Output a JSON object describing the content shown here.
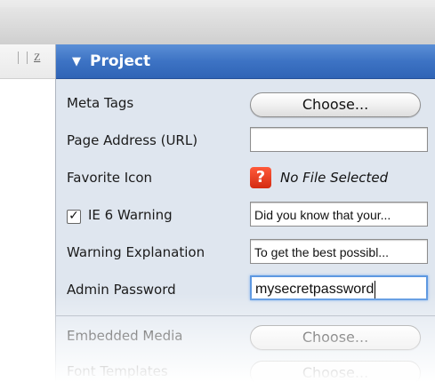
{
  "ruler": {
    "label": "Z"
  },
  "panel": {
    "title": "Project",
    "rows": {
      "meta_tags": {
        "label": "Meta Tags",
        "button": "Choose..."
      },
      "page_address": {
        "label": "Page Address (URL)",
        "value": ""
      },
      "favorite_icon": {
        "label": "Favorite Icon",
        "icon_symbol": "?",
        "status": "No File Selected"
      },
      "ie6_warning": {
        "label": "IE 6 Warning",
        "checked": true,
        "check_symbol": "✓",
        "value": "Did you know that your..."
      },
      "warning_explanation": {
        "label": "Warning Explanation",
        "value": "To get the best possibl..."
      },
      "admin_password": {
        "label": "Admin Password",
        "value": "mysecretpassword"
      },
      "embedded_media": {
        "label": "Embedded Media",
        "button": "Choose..."
      },
      "font_templates": {
        "label": "Font Templates",
        "button": "Choose..."
      }
    }
  },
  "colors": {
    "header_blue": "#3d73c4",
    "panel_bg": "#dfe6ef",
    "warning_red": "#d42b12",
    "focus_blue": "#5d98e1"
  },
  "icons": {
    "collapse": "triangle-down-icon",
    "missing_file": "question-mark-icon",
    "checkbox": "checkmark-icon"
  }
}
